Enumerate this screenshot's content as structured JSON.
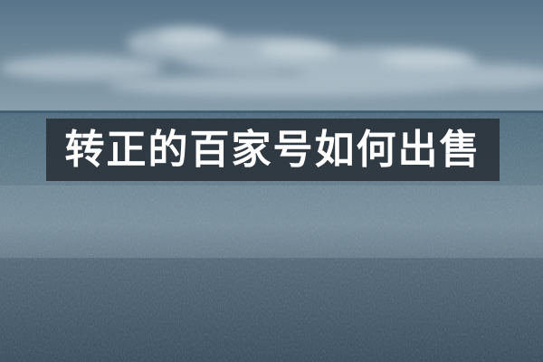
{
  "banner": {
    "title": "转正的百家号如何出售"
  },
  "colors": {
    "sky_top": "#5d7a8d",
    "sky_bottom": "#7f97a6",
    "sea_far": "#4b6b7e",
    "sea_near": "#3a5263",
    "banner_bg": "#282e36",
    "title_text": "#ffffff"
  }
}
